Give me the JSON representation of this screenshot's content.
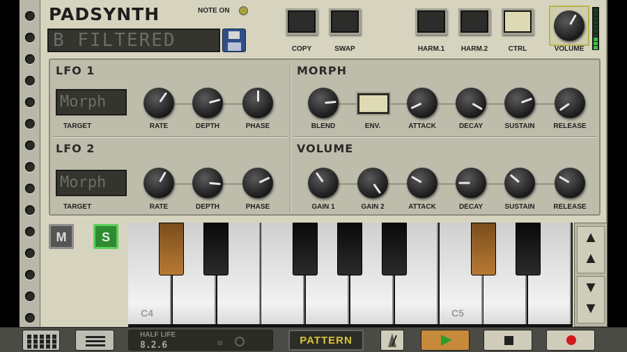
{
  "app": {
    "title": "PADSYNTH",
    "note_on_label": "NOTE ON",
    "preset_name": "B FILTERED"
  },
  "top_buttons": [
    {
      "label": "COPY",
      "lit": false
    },
    {
      "label": "SWAP",
      "lit": false
    },
    {
      "label": "HARM.1",
      "lit": false
    },
    {
      "label": "HARM.2",
      "lit": false
    },
    {
      "label": "CTRL",
      "lit": true
    }
  ],
  "volume_label": "VOLUME",
  "lfo1": {
    "title": "LFO 1",
    "target_value": "Morph",
    "target_label": "TARGET",
    "knobs": [
      "RATE",
      "DEPTH",
      "PHASE"
    ]
  },
  "lfo2": {
    "title": "LFO 2",
    "target_value": "Morph",
    "target_label": "TARGET",
    "knobs": [
      "RATE",
      "DEPTH",
      "PHASE"
    ]
  },
  "morph": {
    "title": "MORPH",
    "labels": [
      "BLEND",
      "ENV.",
      "ATTACK",
      "DECAY",
      "SUSTAIN",
      "RELEASE"
    ]
  },
  "volume_section": {
    "title": "VOLUME",
    "labels": [
      "GAIN 1",
      "GAIN 2",
      "ATTACK",
      "DECAY",
      "SUSTAIN",
      "RELEASE"
    ]
  },
  "mute_solo": {
    "mute": "M",
    "solo": "S"
  },
  "keyboard": {
    "octave_labels": [
      "C4",
      "C5"
    ]
  },
  "octave": {
    "up": "▲",
    "down": "▼"
  },
  "toolbar": {
    "song_title": "HALF LIFE",
    "version": "8.2.6",
    "pattern_label": "PATTERN"
  },
  "colors": {
    "device_body": "#d6d4bf",
    "panel": "#bebcaa",
    "accent_green": "#2f8b2f",
    "highlight_key": "#b87a34",
    "pattern_text": "#d8c53a",
    "play_button": "#c78a3a",
    "record": "#d21a1a"
  }
}
